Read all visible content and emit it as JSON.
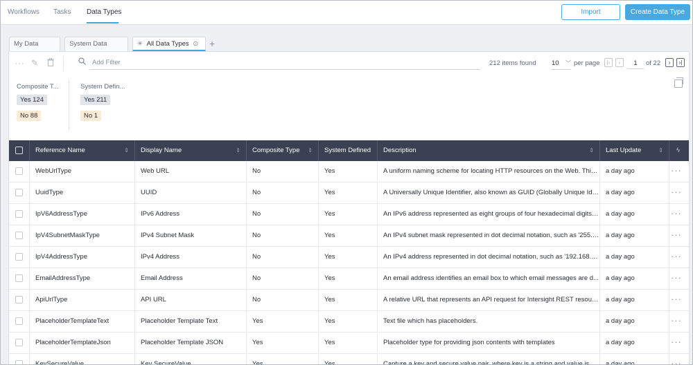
{
  "topbar": {
    "nav": [
      "Workflows",
      "Tasks",
      "Data Types"
    ],
    "import_label": "Import",
    "create_label": "Create Data Type"
  },
  "tabs": [
    {
      "label": "My Data Types"
    },
    {
      "label": "System Data Types"
    },
    {
      "label": "All Data Types"
    }
  ],
  "toolbar": {
    "filter_placeholder": "Add Filter",
    "items_found": "212 items found",
    "per_page_value": "10",
    "per_page_label": "per page",
    "current_page": "1",
    "of_pages": "of 22"
  },
  "summary": {
    "composite": {
      "title": "Composite T...",
      "yes": "Yes  124",
      "no": "No  88"
    },
    "system": {
      "title": "System Defin...",
      "yes": "Yes  211",
      "no": "No  1"
    }
  },
  "columns": [
    "Reference Name",
    "Display Name",
    "Composite Type",
    "System Defined",
    "Description",
    "Last Update"
  ],
  "rows": [
    [
      "WebUrlType",
      "Web URL",
      "No",
      "Yes",
      "A uniform naming scheme for locating HTTP resources on the Web. This...",
      "a day ago"
    ],
    [
      "UuidType",
      "UUID",
      "No",
      "Yes",
      "A Universally Unique Identifier, also known as GUID (Globally Unique Iden...",
      "a day ago"
    ],
    [
      "IpV6AddressType",
      "IPv6 Address",
      "No",
      "Yes",
      "An IPv6 address represented as eight groups of four hexadecimal digits, ...",
      "a day ago"
    ],
    [
      "IpV4SubnetMaskType",
      "IPv4 Subnet Mask",
      "No",
      "Yes",
      "An IPv4 subnet mask represented in dot decimal notation, such as '255.2...",
      "a day ago"
    ],
    [
      "IpV4AddressType",
      "IPv4 Address",
      "No",
      "Yes",
      "An IPv4 address represented in dot decimal notation, such as '192.168.1....",
      "a day ago"
    ],
    [
      "EmailAddressType",
      "Email Address",
      "No",
      "Yes",
      "An email address identifies an email box to which email messages are d...",
      "a day ago"
    ],
    [
      "ApiUrlType",
      "API URL",
      "No",
      "Yes",
      "A relative URL that represents an API request for Intersight REST resource.",
      "a day ago"
    ],
    [
      "PlaceholderTemplateText",
      "Placeholder Template Text",
      "Yes",
      "Yes",
      "Text file which has placeholders.",
      "a day ago"
    ],
    [
      "PlaceholderTemplateJson",
      "Placeholder Template JSON",
      "Yes",
      "Yes",
      "Placeholder type for providing json contents with templates",
      "a day ago"
    ],
    [
      "KeySecureValue",
      "Key SecureValue",
      "Yes",
      "Yes",
      "Capture a key and secure value pair, where key is a string and value is a s...",
      "a day ago"
    ]
  ]
}
